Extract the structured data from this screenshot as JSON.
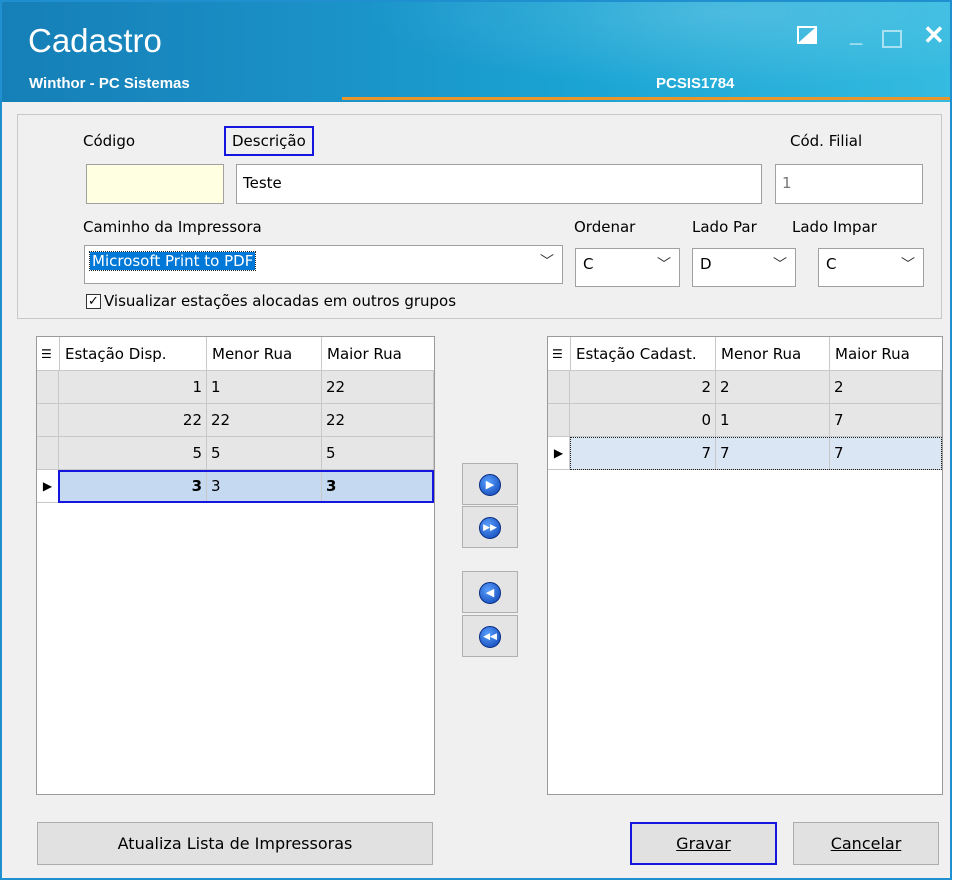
{
  "window": {
    "title": "Cadastro",
    "subtitle": "Winthor - PC Sistemas",
    "code": "PCSIS1784",
    "controls": {
      "restore": "◪",
      "minimize": "_",
      "maximize": "□",
      "close": "✕"
    }
  },
  "form": {
    "codigo_label": "Código",
    "codigo_value": "",
    "descricao_label": "Descrição",
    "descricao_value": "Teste",
    "filial_label": "Cód. Filial",
    "filial_value": "1",
    "impressora_label": "Caminho da Impressora",
    "impressora_value": "Microsoft Print to PDF",
    "ordenar_label": "Ordenar",
    "ordenar_value": "C",
    "lado_par_label": "Lado Par",
    "lado_par_value": "D",
    "lado_impar_label": "Lado Impar",
    "lado_impar_value": "C",
    "visualizar_label": "Visualizar estações alocadas em outros grupos",
    "visualizar_checked": true
  },
  "left_grid": {
    "headers": [
      "Estação Disp.",
      "Menor Rua",
      "Maior Rua"
    ],
    "rows": [
      [
        "1",
        "1",
        "22"
      ],
      [
        "22",
        "22",
        "22"
      ],
      [
        "5",
        "5",
        "5"
      ],
      [
        "3",
        "3",
        "3"
      ]
    ],
    "selected_row": 3
  },
  "right_grid": {
    "headers": [
      "Estação Cadast.",
      "Menor Rua",
      "Maior Rua"
    ],
    "rows": [
      [
        "2",
        "2",
        "2"
      ],
      [
        "0",
        "1",
        "7"
      ],
      [
        "7",
        "7",
        "7"
      ]
    ],
    "selected_row": 2
  },
  "move_buttons": {
    "move_right": "move-right-icon",
    "move_all_right": "move-all-right-icon",
    "move_left": "move-left-icon",
    "move_all_left": "move-all-left-icon"
  },
  "buttons": {
    "atualiza": "Atualiza Lista de Impressoras",
    "gravar": "Gravar",
    "cancelar": "Cancelar"
  },
  "colors": {
    "title_bar": "#1a92c8",
    "highlight_border": "#1515e0",
    "selection": "#c5d9f1",
    "codigo_bg": "#ffffe1"
  }
}
